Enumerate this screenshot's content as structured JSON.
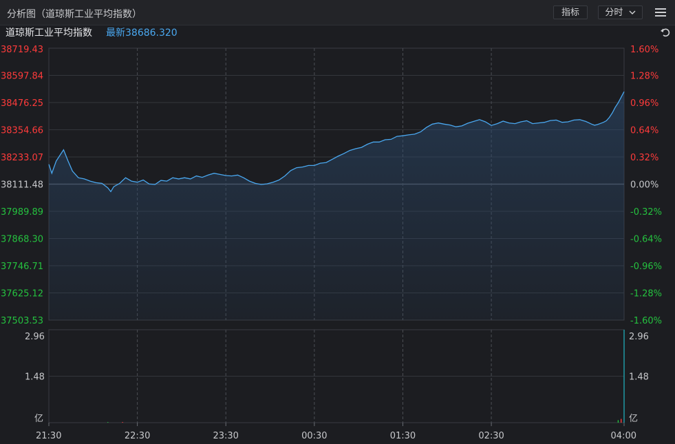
{
  "header": {
    "title": "分析图（道琼斯工业平均指数）",
    "indicator_button": "指标",
    "period_button": "分时"
  },
  "legend": {
    "name": "道琼斯工业平均指数",
    "latest": "最新38686.320"
  },
  "colors": {
    "up": "#ff3b3b",
    "down": "#25c23f",
    "line": "#4aa8f0",
    "flat": "#c8c9cc"
  },
  "chart_data": {
    "type": "line",
    "base_value": 38111.48,
    "ylim": [
      37503.53,
      38719.43
    ],
    "y_ticks_left": [
      "38719.43",
      "38597.84",
      "38476.25",
      "38354.66",
      "38233.07",
      "38111.48",
      "37989.89",
      "37868.30",
      "37746.71",
      "37625.12",
      "37503.53"
    ],
    "y_ticks_right": [
      "1.60%",
      "1.28%",
      "0.96%",
      "0.64%",
      "0.32%",
      "0.00%",
      "-0.32%",
      "-0.64%",
      "-0.96%",
      "-1.28%",
      "-1.60%"
    ],
    "x_ticks": [
      "21:30",
      "22:30",
      "23:30",
      "00:30",
      "01:30",
      "02:30",
      "04:00"
    ],
    "x_tick_minutes": [
      0,
      60,
      120,
      180,
      240,
      300,
      390
    ],
    "series": [
      {
        "x_minutes": [
          0,
          2,
          5,
          8,
          10,
          13,
          16,
          20,
          24,
          28,
          32,
          36,
          40,
          42,
          44,
          48,
          52,
          56,
          60,
          64,
          68,
          72,
          76,
          80,
          84,
          88,
          92,
          96,
          100,
          104,
          108,
          112,
          116,
          120,
          124,
          128,
          132,
          136,
          140,
          144,
          148,
          152,
          156,
          160,
          164,
          168,
          172,
          176,
          180,
          184,
          188,
          192,
          196,
          200,
          204,
          208,
          212,
          216,
          220,
          224,
          228,
          232,
          236,
          240,
          244,
          248,
          252,
          256,
          260,
          264,
          268,
          272,
          276,
          280,
          284,
          288,
          292,
          296,
          300,
          304,
          308,
          312,
          316,
          320,
          324,
          328,
          332,
          336,
          340,
          344,
          348,
          352,
          356,
          360,
          362,
          364,
          366,
          368,
          370,
          372,
          374,
          376,
          378,
          380,
          382,
          384,
          386,
          388,
          390
        ],
        "values": [
          38200,
          38160,
          38215,
          38245,
          38265,
          38215,
          38170,
          38140,
          38135,
          38125,
          38118,
          38115,
          38095,
          38078,
          38100,
          38115,
          38140,
          38125,
          38120,
          38130,
          38112,
          38110,
          38128,
          38125,
          38140,
          38135,
          38140,
          38135,
          38148,
          38142,
          38152,
          38160,
          38155,
          38150,
          38148,
          38152,
          38140,
          38125,
          38115,
          38110,
          38113,
          38120,
          38130,
          38148,
          38172,
          38185,
          38188,
          38195,
          38195,
          38205,
          38208,
          38222,
          38236,
          38248,
          38262,
          38270,
          38276,
          38290,
          38300,
          38300,
          38310,
          38312,
          38325,
          38328,
          38332,
          38335,
          38345,
          38365,
          38380,
          38385,
          38380,
          38376,
          38368,
          38372,
          38384,
          38392,
          38400,
          38390,
          38374,
          38382,
          38393,
          38385,
          38382,
          38390,
          38395,
          38382,
          38385,
          38388,
          38396,
          38398,
          38388,
          38390,
          38398,
          38400,
          38396,
          38392,
          38386,
          38380,
          38375,
          38378,
          38383,
          38388,
          38395,
          38410,
          38430,
          38455,
          38475,
          38500,
          38525,
          38550,
          38580,
          38620,
          38650,
          38686,
          38700,
          38686
        ]
      }
    ],
    "volume_panel": {
      "y_ticks": [
        "2.96",
        "1.48"
      ],
      "unit": "亿",
      "ylim": [
        0,
        2.96
      ],
      "bars_minutes": [
        40,
        50,
        386,
        388,
        390
      ],
      "bars_values": [
        0.02,
        0.02,
        0.08,
        0.12,
        2.96
      ]
    }
  }
}
